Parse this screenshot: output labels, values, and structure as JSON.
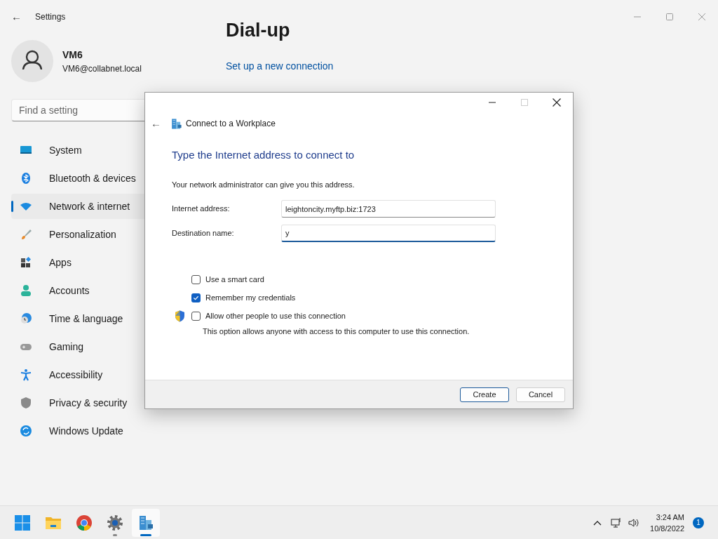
{
  "window": {
    "title": "Settings",
    "back": "←"
  },
  "user": {
    "name": "VM6",
    "email": "VM6@collabnet.local"
  },
  "search": {
    "placeholder": "Find a setting"
  },
  "sidebar": {
    "items": [
      {
        "label": "System",
        "selected": false
      },
      {
        "label": "Bluetooth & devices",
        "selected": false
      },
      {
        "label": "Network & internet",
        "selected": true
      },
      {
        "label": "Personalization",
        "selected": false
      },
      {
        "label": "Apps",
        "selected": false
      },
      {
        "label": "Accounts",
        "selected": false
      },
      {
        "label": "Time & language",
        "selected": false
      },
      {
        "label": "Gaming",
        "selected": false
      },
      {
        "label": "Accessibility",
        "selected": false
      },
      {
        "label": "Privacy & security",
        "selected": false
      },
      {
        "label": "Windows Update",
        "selected": false
      }
    ]
  },
  "page": {
    "title": "Dial-up",
    "link": "Set up a new connection"
  },
  "dialog": {
    "title": "Connect to a Workplace",
    "back": "←",
    "heading": "Type the Internet address to connect to",
    "intro": "Your network administrator can give you this address.",
    "fields": [
      {
        "label": "Internet address:",
        "value": "leightoncity.myftp.biz:1723",
        "focused": false
      },
      {
        "label": "Destination name:",
        "value": "y",
        "focused": true
      }
    ],
    "options": [
      {
        "label": "Use a smart card",
        "checked": false,
        "shield": false
      },
      {
        "label": "Remember my credentials",
        "checked": true,
        "shield": false
      },
      {
        "label": "Allow other people to use this connection",
        "checked": false,
        "shield": true,
        "note": "This option allows anyone with access to this computer to use this connection."
      }
    ],
    "buttons": [
      {
        "label": "Create",
        "default": true
      },
      {
        "label": "Cancel",
        "default": false
      }
    ]
  },
  "taskbar": {
    "apps": [
      {
        "selected": false,
        "running": false
      },
      {
        "selected": false,
        "running": false
      },
      {
        "selected": false,
        "running": false
      },
      {
        "selected": false,
        "running": true
      },
      {
        "selected": true,
        "running": true
      }
    ],
    "time": "3:24 AM",
    "date": "10/8/2022",
    "notifications": "1"
  }
}
